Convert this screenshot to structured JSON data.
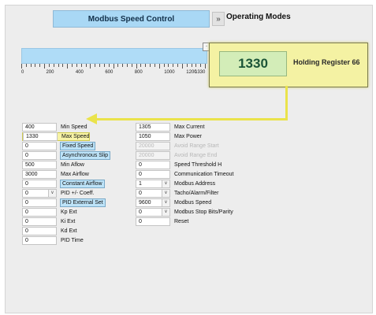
{
  "header": {
    "title": "Modbus Speed Control",
    "mode_button": "»",
    "mode_label": "Operating Modes"
  },
  "slider": {
    "value_fraction": 1.0,
    "handle_glyph": "-",
    "tick_labels": [
      "0",
      "200",
      "400",
      "600",
      "800",
      "1000",
      "1200",
      "1330"
    ]
  },
  "register": {
    "value": "1330",
    "label": "Holding Register 66"
  },
  "left_params": [
    {
      "value": "400",
      "label": "Min Speed"
    },
    {
      "value": "1330",
      "label": "Max Speed",
      "highlight": true
    },
    {
      "value": "0",
      "label": "Fixed Speed",
      "tag": true
    },
    {
      "value": "0",
      "label": "Asynchronous Slip",
      "tag": true
    },
    {
      "value": "500",
      "label": "Min Aflow"
    },
    {
      "value": "3000",
      "label": "Max Airflow"
    },
    {
      "value": "0",
      "label": "Constant Airflow",
      "tag": true
    },
    {
      "value": "0",
      "label": "PID +/- Coeff.",
      "dropdown": true
    },
    {
      "value": "0",
      "label": "PID External Set",
      "tag": true
    },
    {
      "value": "0",
      "label": "Kp Ext"
    },
    {
      "value": "0",
      "label": "Ki Ext"
    },
    {
      "value": "0",
      "label": "Kd Ext"
    },
    {
      "value": "0",
      "label": "PID Time"
    }
  ],
  "right_params": [
    {
      "value": "1305",
      "label": "Max Current"
    },
    {
      "value": "1050",
      "label": "Max Power"
    },
    {
      "value": "20000",
      "label": "Avoid Range Start",
      "disabled": true
    },
    {
      "value": "20000",
      "label": "Avoid Range End",
      "disabled": true
    },
    {
      "value": "0",
      "label": "Speed Threshold H"
    },
    {
      "value": "0",
      "label": "Communication Timeout"
    },
    {
      "value": "1",
      "label": "Modbus Address",
      "dropdown": true
    },
    {
      "value": "0",
      "label": "Tacho/Alarm/Filter",
      "dropdown": true
    },
    {
      "value": "9600",
      "label": "Modbus Speed",
      "dropdown": true
    },
    {
      "value": "0",
      "label": "Modbus Stop Bits/Parity",
      "dropdown": true
    },
    {
      "value": "0",
      "label": "Reset"
    }
  ],
  "colors": {
    "title_bg": "#a9d8f5",
    "register_box": "#f4f2a3",
    "register_value_bg": "#d3edb8",
    "callout": "#eae34b",
    "tag_bg": "#bde3f8"
  }
}
